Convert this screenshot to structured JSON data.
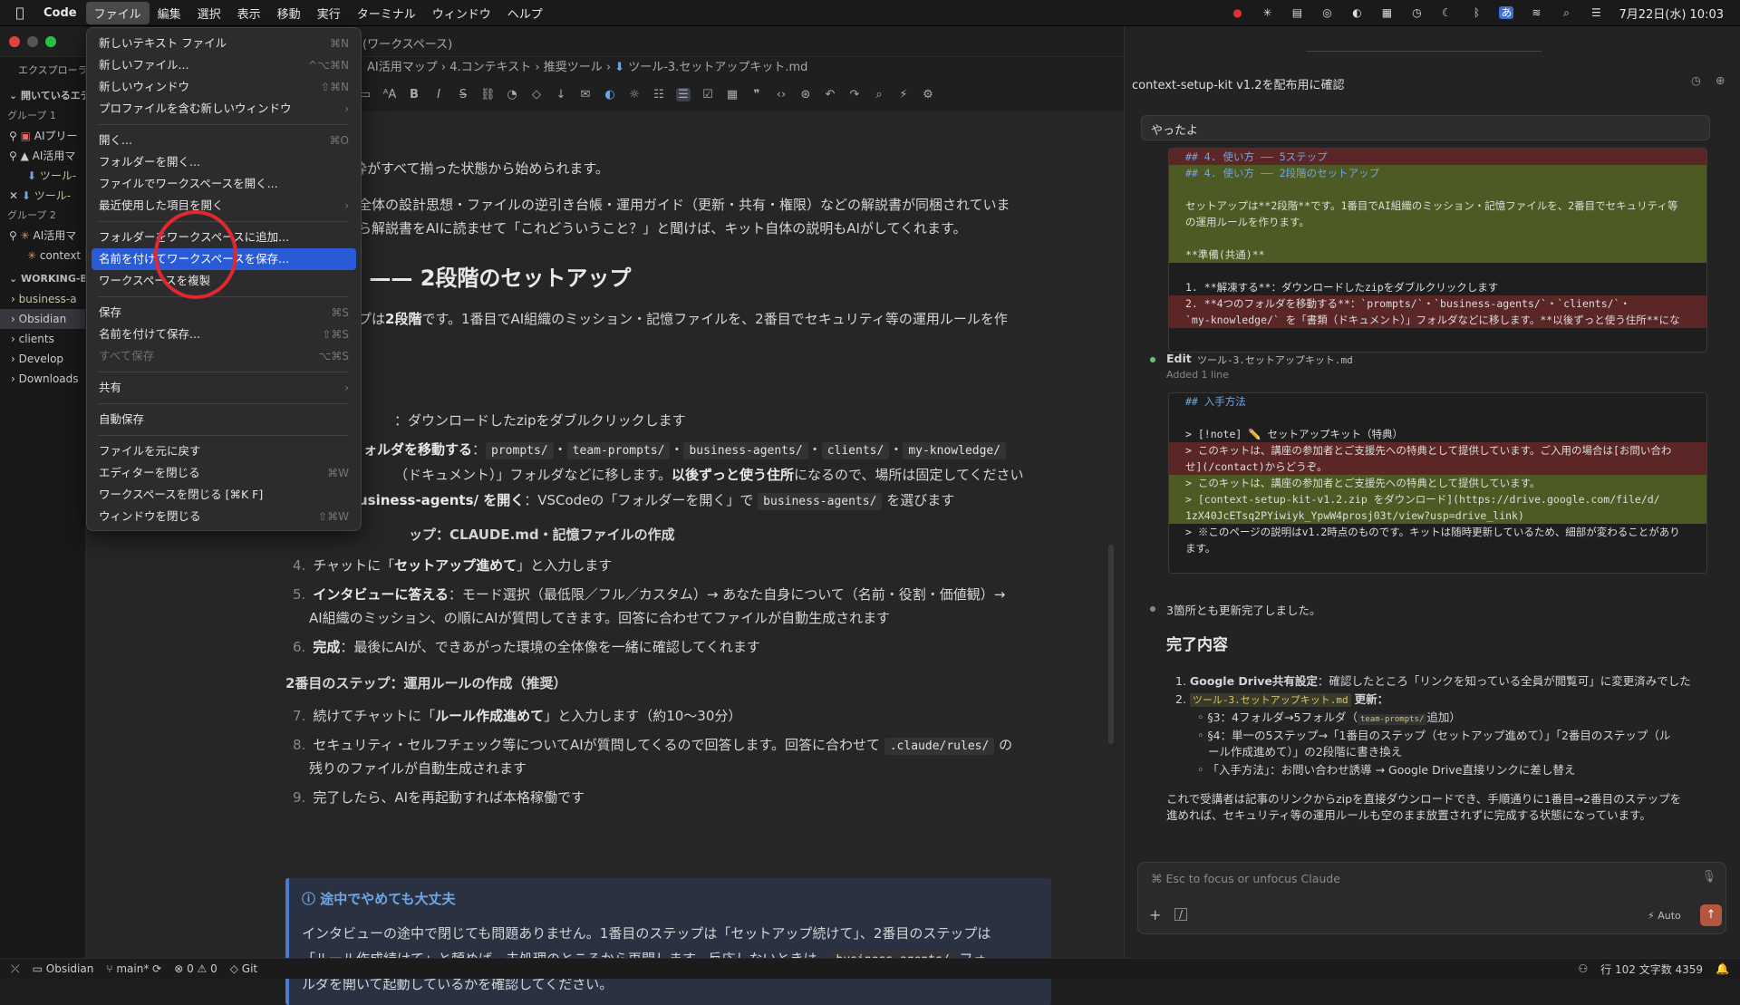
{
  "menubar": {
    "app": "Code",
    "items": [
      "ファイル",
      "編集",
      "選択",
      "表示",
      "移動",
      "実行",
      "ターミナル",
      "ウィンドウ",
      "ヘルプ"
    ],
    "clock": "7月22日(水) 10:03"
  },
  "window": {
    "title": "(ワークスペース)"
  },
  "sidebar": {
    "explorer": "エクスプローラ",
    "open_editors": "開いているエディター",
    "group1": "グループ 1",
    "g1_items": [
      "AIプリー",
      "AI活用マ",
      "ツール-"
    ],
    "g1_last": "ツール-",
    "group2": "グループ 2",
    "g2_items": [
      "AI活用マ",
      "context"
    ],
    "workspace": "WORKING-BA",
    "folders": [
      "business-a",
      "Obsidian",
      "clients",
      "Develop",
      "Downloads"
    ]
  },
  "breadcrumb": [
    "AI活用マップ",
    "4.コンテキスト",
    "推奨ツール",
    "ツール-3.セットアップキット.md"
  ],
  "file_menu": {
    "items": [
      {
        "label": "新しいテキスト ファイル",
        "sc": "⌘N"
      },
      {
        "label": "新しいファイル...",
        "sc": "^⌥⌘N"
      },
      {
        "label": "新しいウィンドウ",
        "sc": "⇧⌘N"
      },
      {
        "label": "プロファイルを含む新しいウィンドウ",
        "sc": "›"
      },
      {
        "label": "開く...",
        "sc": "⌘O"
      },
      {
        "label": "フォルダーを開く...",
        "sc": ""
      },
      {
        "label": "ファイルでワークスペースを開く...",
        "sc": ""
      },
      {
        "label": "最近使用した項目を開く",
        "sc": "›"
      },
      {
        "label": "フォルダーをワークスペースに追加...",
        "sc": ""
      },
      {
        "label": "名前を付けてワークスペースを保存...",
        "sc": ""
      },
      {
        "label": "ワークスペースを複製",
        "sc": ""
      },
      {
        "label": "保存",
        "sc": "⌘S"
      },
      {
        "label": "名前を付けて保存...",
        "sc": "⇧⌘S"
      },
      {
        "label": "すべて保存",
        "sc": "⌥⌘S"
      },
      {
        "label": "共有",
        "sc": "›"
      },
      {
        "label": "自動保存",
        "sc": ""
      },
      {
        "label": "ファイルを元に戻す",
        "sc": ""
      },
      {
        "label": "エディターを閉じる",
        "sc": "⌘W"
      },
      {
        "label": "ワークスペースを閉じる [⌘K F]",
        "sc": ""
      },
      {
        "label": "ウィンドウを閉じる",
        "sc": "⇧⌘W"
      }
    ]
  },
  "doc": {
    "l1": "心）の枠がすべて揃った状態から始められます。",
    "l2": "全体の設計思想・ファイルの逆引き台帳・運用ガイド（更新・共有・権限）などの解説書が同梱されていま",
    "l3": "ら解説書をAIに読ませて「これどういうこと？」と聞けば、キット自体の説明もAIがしてくれます。",
    "h2": "方 —— 2段階のセットアップ",
    "l4a": "プは",
    "l4b": "2段階",
    "l4c": "です。1番目でAI組織のミッション・記憶ファイルを、2番目でセキュリティ等の運用ルールを作",
    "s1": "：ダウンロードしたzipをダブルクリックします",
    "s2a": "ォルダを移動する",
    "s2codes": [
      "prompts/",
      "team-prompts/",
      "business-agents/",
      "clients/",
      "my-knowledge/"
    ],
    "s2b": "（ドキュメント）」フォルダなどに移します。",
    "s2c": "以後ずっと使う住所",
    "s2d": "になるので、場所は固定してください",
    "s3a": "usiness-agents/ を開く",
    "s3b": "：VSCodeの「フォルダーを開く」で",
    "s3code": "business-agents/",
    "s3c": "を選びます",
    "h3a": "ップ：CLAUDE.md・記憶ファイルの作成",
    "i4": "チャットに「",
    "i4b": "セットアップ進めて",
    "i4c": "」と入力します",
    "i5a": "インタビューに答える",
    "i5b": "：モード選択（最低限／フル／カスタム）→ あなた自身について（名前・役割・価値観）→",
    "i5c": "AI組織のミッション、の順にAIが質問してきます。回答に合わせてファイルが自動生成されます",
    "i6a": "完成",
    "i6b": "：最後にAIが、できあがった環境の全体像を一緒に確認してくれます",
    "h3b": "2番目のステップ：運用ルールの作成（推奨）",
    "i7a": "続けてチャットに「",
    "i7b": "ルール作成進めて",
    "i7c": "」と入力します（約10〜30分）",
    "i8a": "セキュリティ・セルフチェック等についてAIが質問してくるので回答します。回答に合わせて",
    "i8code": ".claude/rules/",
    "i8b": "の",
    "i8c": "残りのファイルが自動生成されます",
    "i9": "完了したら、AIを再起動すれば本格稼働です",
    "note_title": "途中でやめても大丈夫",
    "note1": "インタビューの途中で閉じても問題ありません。1番目のステップは「セットアップ続けて」、2番目のステップは",
    "note2a": "「ルール作成続けて」と頼めば、未処理のところから再開します。反応しないときは、",
    "note2code": "business-agents/",
    "note2b": "フォ",
    "note3": "ルダを開いて起動しているかを確認してください。",
    "nums": [
      "4.",
      "5.",
      "6.",
      "7.",
      "8.",
      "9."
    ]
  },
  "chat": {
    "title": "context-setup-kit v1.2を配布用に確認",
    "user_msg": "やったよ",
    "diff1": [
      {
        "t": "del",
        "s": "## 4. 使い方 —— 5ステップ"
      },
      {
        "t": "add",
        "s": "## 4. 使い方 —— 2段階のセットアップ"
      },
      {
        "t": "add",
        "s": ""
      },
      {
        "t": "add",
        "s": "セットアップは**2段階**です。1番目でAI組織のミッション・記憶ファイルを、2番目でセキュリティ等"
      },
      {
        "t": "add",
        "s": "の運用ルールを作ります。"
      },
      {
        "t": "add",
        "s": ""
      },
      {
        "t": "add",
        "s": "**準備(共通)**"
      },
      {
        "t": "ctx",
        "s": ""
      },
      {
        "t": "ctx",
        "s": "1. **解凍する**：ダウンロードしたzipをダブルクリックします"
      },
      {
        "t": "del",
        "s": "2. **4つのフォルダを移動する**：`prompts/`・`business-agents/`・`clients/`・"
      },
      {
        "t": "del",
        "s": "`my-knowledge/` を「書類（ドキュメント）」フォルダなどに移します。**以後ずっと使う住所**にな"
      }
    ],
    "edit_label": "Edit",
    "edit_file": "ツール-3.セットアップキット.md",
    "edit_added": "Added 1 line",
    "diff2": [
      {
        "t": "ctx",
        "s": "## 入手方法"
      },
      {
        "t": "ctx",
        "s": ""
      },
      {
        "t": "ctx",
        "s": "> [!note] ✏️ セットアップキット（特典）"
      },
      {
        "t": "del",
        "s": "> このキットは、講座の参加者とご支援先への特典として提供しています。ご入用の場合は[お問い合わ"
      },
      {
        "t": "del",
        "s": "せ](/contact)からどうぞ。"
      },
      {
        "t": "add",
        "s": "> このキットは、講座の参加者とご支援先への特典として提供しています。"
      },
      {
        "t": "add",
        "s": "> [context-setup-kit-v1.2.zip をダウンロード](https://drive.google.com/file/d/"
      },
      {
        "t": "add",
        "s": "1zX40JcETsq2PYiwiyk_YpwW4prosj03t/view?usp=drive_link)"
      },
      {
        "t": "ctx",
        "s": "> ※このページの説明はv1.2時点のものです。キットは随時更新しているため、細部が変わることがあり"
      },
      {
        "t": "ctx",
        "s": "ます。"
      }
    ],
    "done_msg": "3箇所とも更新完了しました。",
    "done_title": "完了内容",
    "d1a": "Google Drive共有設定",
    "d1b": "：確認したところ「リンクを知っている全員が閲覧可」に変更済みでした",
    "d2code": "ツール-3.セットアップキット.md",
    "d2b": "更新：",
    "sub1a": "§3：4フォルダ→5フォルダ（",
    "sub1code": "team-prompts/",
    "sub1b": "追加）",
    "sub2a": "§4：単一の5ステップ→「1番目のステップ（セットアップ進めて）」「2番目のステップ（ル",
    "sub2b": "ール作成進めて）」の2段階に書き換え",
    "sub3": "「入手方法」：お問い合わせ誘導 → Google Drive直接リンクに差し替え",
    "summary1": "これで受講者は記事のリンクからzipを直接ダウンロードでき、手順通りに1番目→2番目のステップを",
    "summary2": "進めれば、セキュリティ等の運用ルールも空のまま放置されずに完成する状態になっています。",
    "input_placeholder": "⌘ Esc to focus or unfocus Claude",
    "auto_label": "Auto"
  },
  "status": {
    "repo": "Obsidian",
    "branch": "main*",
    "errors": "0",
    "warnings": "0",
    "git": "Git",
    "position": "行 102 文字数 4359"
  }
}
